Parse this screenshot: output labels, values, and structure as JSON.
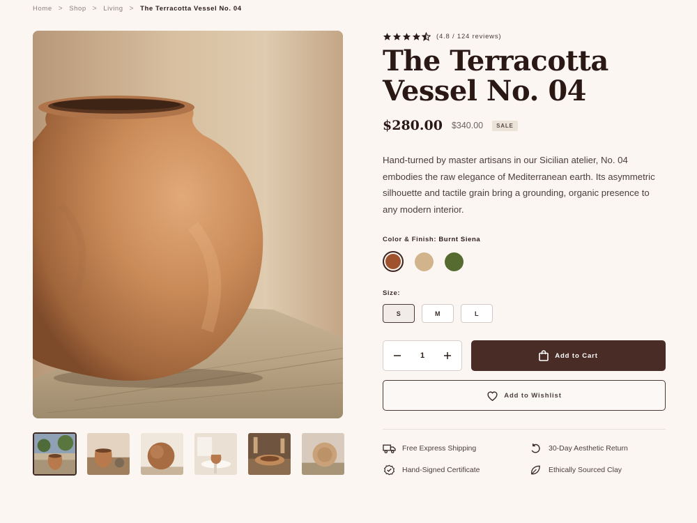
{
  "breadcrumb": {
    "items": [
      "Home",
      "Shop",
      "Living"
    ],
    "current": "The Terracotta Vessel No. 04",
    "separator": ">"
  },
  "product": {
    "rating": 4.5,
    "rating_text": "(4.8 / 124 reviews)",
    "title_line1": "The Terracotta",
    "title_line2": "Vessel No. 04",
    "price": "$280.00",
    "old_price": "$340.00",
    "sale_badge": "SALE",
    "description": "Hand-turned by master artisans in our Sicilian atelier, No. 04 embodies the raw elegance of Mediterranean earth. Its asymmetric silhouette and tactile grain bring a grounding, organic presence to any modern interior."
  },
  "color": {
    "label": "Color & Finish:",
    "selected_name": "Burnt Siena",
    "swatches": [
      {
        "name": "burnt-siena",
        "hex": "#a0522d",
        "selected": true
      },
      {
        "name": "sand",
        "hex": "#d2b48c",
        "selected": false
      },
      {
        "name": "olive",
        "hex": "#556b2f",
        "selected": false
      }
    ]
  },
  "size": {
    "label": "Size:",
    "options": [
      "S",
      "M",
      "L"
    ],
    "selected": "S"
  },
  "cart": {
    "quantity": "1",
    "minus": "−",
    "plus": "+",
    "add_to_cart": "Add to Cart",
    "add_to_wishlist": "Add to Wishlist"
  },
  "features": [
    {
      "icon": "truck-icon",
      "label": "Free Express Shipping"
    },
    {
      "icon": "return-icon",
      "label": "30-Day Aesthetic Return"
    },
    {
      "icon": "certificate-icon",
      "label": "Hand-Signed Certificate"
    },
    {
      "icon": "leaf-icon",
      "label": "Ethically Sourced Clay"
    }
  ],
  "colors": {
    "background": "#fcf6f3",
    "primary_dark": "#4a2c26",
    "text": "#2a1b17"
  }
}
